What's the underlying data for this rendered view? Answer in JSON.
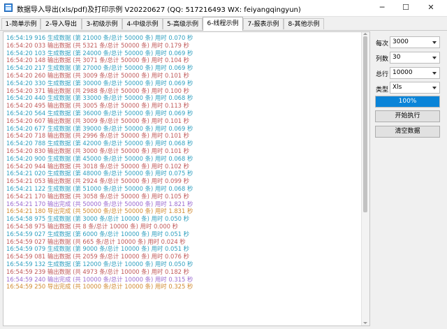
{
  "window": {
    "title": "数据导入导出(xls/pdf)及打印示例 V20220627 (QQ: 517216493 WX: feiyangqingyun)",
    "icon": "app-window-icon",
    "controls": {
      "minimize": "─",
      "maximize": "☐",
      "close": "✕"
    }
  },
  "tabs": [
    {
      "label": "1-简单示例"
    },
    {
      "label": "2-导入导出"
    },
    {
      "label": "3-初级示例"
    },
    {
      "label": "4-中级示例"
    },
    {
      "label": "5-高级示例"
    },
    {
      "label": "6-线程示例"
    },
    {
      "label": "7-报表示例"
    },
    {
      "label": "8-其他示例"
    }
  ],
  "active_tab": 5,
  "log_lines": [
    {
      "text": "16:54:19 916 生成数据 (第 21000 条/总计 50000 条) 用时 0.070 秒",
      "kind": "c1"
    },
    {
      "text": "16:54:20 033 输出数据 (共 5321 条/总计 50000 条) 用时 0.179 秒",
      "kind": "c2"
    },
    {
      "text": "16:54:20 103 生成数据 (第 24000 条/总计 50000 条) 用时 0.069 秒",
      "kind": "c1"
    },
    {
      "text": "16:54:20 148 输出数据 (共 3071 条/总计 50000 条) 用时 0.104 秒",
      "kind": "c2"
    },
    {
      "text": "16:54:20 217 生成数据 (第 27000 条/总计 50000 条) 用时 0.069 秒",
      "kind": "c1"
    },
    {
      "text": "16:54:20 260 输出数据 (共 3009 条/总计 50000 条) 用时 0.101 秒",
      "kind": "c2"
    },
    {
      "text": "16:54:20 330 生成数据 (第 30000 条/总计 50000 条) 用时 0.069 秒",
      "kind": "c1"
    },
    {
      "text": "16:54:20 371 输出数据 (共 2988 条/总计 50000 条) 用时 0.100 秒",
      "kind": "c2"
    },
    {
      "text": "16:54:20 440 生成数据 (第 33000 条/总计 50000 条) 用时 0.068 秒",
      "kind": "c1"
    },
    {
      "text": "16:54:20 495 输出数据 (共 3005 条/总计 50000 条) 用时 0.113 秒",
      "kind": "c2"
    },
    {
      "text": "16:54:20 564 生成数据 (第 36000 条/总计 50000 条) 用时 0.069 秒",
      "kind": "c1"
    },
    {
      "text": "16:54:20 607 输出数据 (共 3009 条/总计 50000 条) 用时 0.101 秒",
      "kind": "c2"
    },
    {
      "text": "16:54:20 677 生成数据 (第 39000 条/总计 50000 条) 用时 0.069 秒",
      "kind": "c1"
    },
    {
      "text": "16:54:20 718 输出数据 (共 2996 条/总计 50000 条) 用时 0.101 秒",
      "kind": "c2"
    },
    {
      "text": "16:54:20 788 生成数据 (第 42000 条/总计 50000 条) 用时 0.068 秒",
      "kind": "c1"
    },
    {
      "text": "16:54:20 830 输出数据 (共 3000 条/总计 50000 条) 用时 0.101 秒",
      "kind": "c2"
    },
    {
      "text": "16:54:20 900 生成数据 (第 45000 条/总计 50000 条) 用时 0.068 秒",
      "kind": "c1"
    },
    {
      "text": "16:54:20 944 输出数据 (共 3018 条/总计 50000 条) 用时 0.102 秒",
      "kind": "c2"
    },
    {
      "text": "16:54:21 020 生成数据 (第 48000 条/总计 50000 条) 用时 0.075 秒",
      "kind": "c1"
    },
    {
      "text": "16:54:21 053 输出数据 (共 2924 条/总计 50000 条) 用时 0.099 秒",
      "kind": "c2"
    },
    {
      "text": "16:54:21 122 生成数据 (第 51000 条/总计 50000 条) 用时 0.068 秒",
      "kind": "c1"
    },
    {
      "text": "16:54:21 170 输出数据 (共 3058 条/总计 50000 条) 用时 0.105 秒",
      "kind": "c2"
    },
    {
      "text": "16:54:21 170 输出完成 (共 50000 条/总计 50000 条) 用时 1.821 秒",
      "kind": "c3"
    },
    {
      "text": "16:54:21 180 导出完成 (共 50000 条/总计 50000 条) 用时 1.831 秒",
      "kind": "c4"
    },
    {
      "text": "16:54:58 975 生成数据 (第 3000 条/总计 10000 条) 用时 0.050 秒",
      "kind": "c1"
    },
    {
      "text": "16:54:58 975 输出数据 (共 8 条/总计 10000 条) 用时 0.000 秒",
      "kind": "c2"
    },
    {
      "text": "16:54:59 027 生成数据 (第 6000 条/总计 10000 条) 用时 0.051 秒",
      "kind": "c1"
    },
    {
      "text": "16:54:59 027 输出数据 (共 665 条/总计 10000 条) 用时 0.024 秒",
      "kind": "c2"
    },
    {
      "text": "16:54:59 079 生成数据 (第 9000 条/总计 10000 条) 用时 0.051 秒",
      "kind": "c1"
    },
    {
      "text": "16:54:59 081 输出数据 (共 2059 条/总计 10000 条) 用时 0.076 秒",
      "kind": "c2"
    },
    {
      "text": "16:54:59 132 生成数据 (第 12000 条/总计 10000 条) 用时 0.050 秒",
      "kind": "c1"
    },
    {
      "text": "16:54:59 239 输出数据 (共 4973 条/总计 10000 条) 用时 0.182 秒",
      "kind": "c2"
    },
    {
      "text": "16:54:59 240 输出完成 (共 10000 条/总计 10000 条) 用时 0.315 秒",
      "kind": "c3"
    },
    {
      "text": "16:54:59 250 导出完成 (共 10000 条/总计 10000 条) 用时 0.325 秒",
      "kind": "c4"
    }
  ],
  "panel": {
    "per_batch": {
      "label": "每次",
      "value": "3000"
    },
    "columns": {
      "label": "列数",
      "value": "30"
    },
    "total_rows": {
      "label": "总行",
      "value": "10000"
    },
    "type": {
      "label": "类型",
      "value": "Xls"
    },
    "progress": {
      "percent": 100,
      "text": "100%"
    },
    "start_button": "开始执行",
    "clear_button": "清空数据"
  },
  "colors": {
    "progress_fill": "#0a84d8",
    "log_generate": "#2f9fbf",
    "log_output": "#c05a5a",
    "log_output_done": "#9a6ad0",
    "log_export_done": "#d08a30"
  }
}
